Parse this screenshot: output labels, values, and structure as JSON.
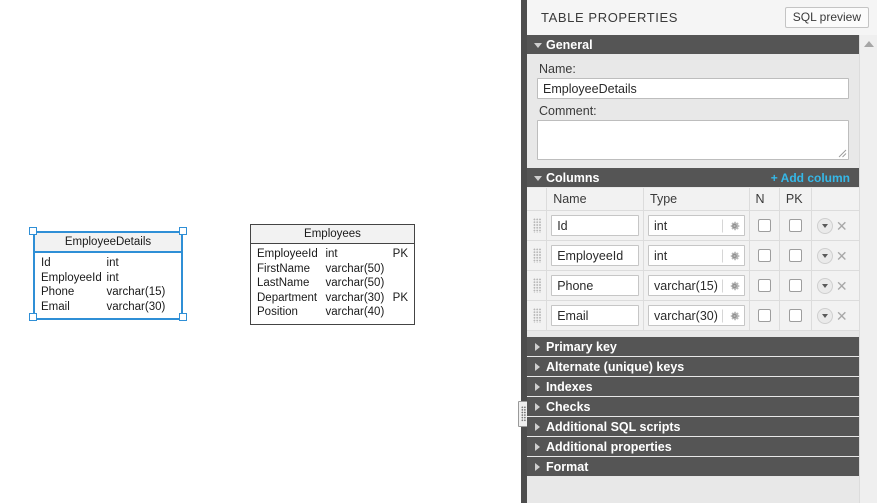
{
  "canvas": {
    "tables": [
      {
        "name": "EmployeeDetails",
        "selected": true,
        "columns": [
          {
            "name": "Id",
            "type": "int",
            "key": ""
          },
          {
            "name": "EmployeeId",
            "type": "int",
            "key": ""
          },
          {
            "name": "Phone",
            "type": "varchar(15)",
            "key": ""
          },
          {
            "name": "Email",
            "type": "varchar(30)",
            "key": ""
          }
        ]
      },
      {
        "name": "Employees",
        "selected": false,
        "columns": [
          {
            "name": "EmployeeId",
            "type": "int",
            "key": "PK"
          },
          {
            "name": "FirstName",
            "type": "varchar(50)",
            "key": ""
          },
          {
            "name": "LastName",
            "type": "varchar(50)",
            "key": ""
          },
          {
            "name": "Department",
            "type": "varchar(30)",
            "key": "PK"
          },
          {
            "name": "Position",
            "type": "varchar(40)",
            "key": ""
          }
        ]
      }
    ]
  },
  "panel": {
    "title": "TABLE PROPERTIES",
    "sql_preview_label": "SQL preview",
    "accent_link_color": "#35b8e8",
    "section_header_bg": "#555555",
    "sections": {
      "general": {
        "label": "General",
        "expanded": true,
        "name_label": "Name:",
        "name_value": "EmployeeDetails",
        "name_placeholder": "",
        "comment_label": "Comment:",
        "comment_value": "",
        "comment_placeholder": ""
      },
      "columns": {
        "label": "Columns",
        "expanded": true,
        "add_column_label": "+ Add column",
        "headers": {
          "name": "Name",
          "type": "Type",
          "n": "N",
          "pk": "PK",
          "actions": ""
        },
        "rows": [
          {
            "name": "Id",
            "type": "int",
            "n": false,
            "pk": false
          },
          {
            "name": "EmployeeId",
            "type": "int",
            "n": false,
            "pk": false
          },
          {
            "name": "Phone",
            "type": "varchar(15)",
            "n": false,
            "pk": false
          },
          {
            "name": "Email",
            "type": "varchar(30)",
            "n": false,
            "pk": false
          }
        ]
      },
      "collapsed": [
        {
          "label": "Primary key"
        },
        {
          "label": "Alternate (unique) keys"
        },
        {
          "label": "Indexes"
        },
        {
          "label": "Checks"
        },
        {
          "label": "Additional SQL scripts"
        },
        {
          "label": "Additional properties"
        },
        {
          "label": "Format"
        }
      ]
    }
  }
}
